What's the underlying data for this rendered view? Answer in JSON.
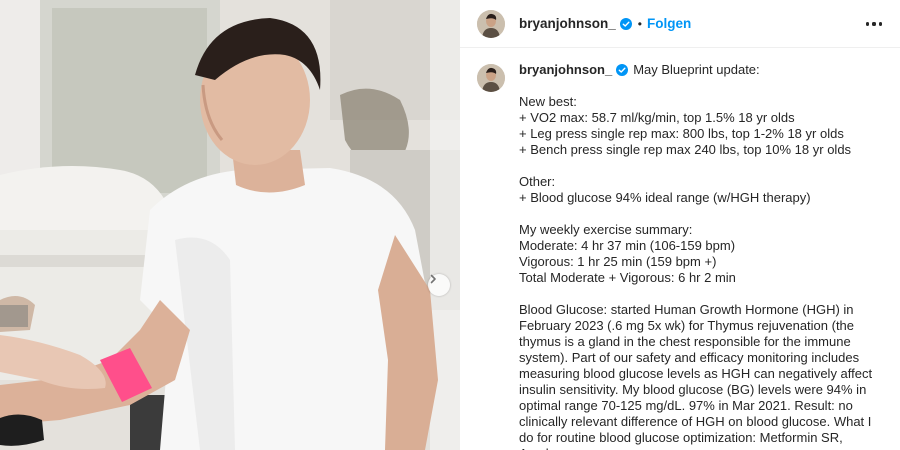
{
  "post": {
    "username": "bryanjohnson_",
    "follow_label": "Folgen",
    "separator": "•",
    "verified_icon": "verified-badge-icon",
    "more_icon": "more-options-icon"
  },
  "caption": {
    "username": "bryanjohnson_",
    "title": "May Blueprint update:",
    "new_best": {
      "heading": "New best:",
      "lines": [
        "+ VO2 max: 58.7 ml/kg/min, top 1.5% 18 yr olds",
        "+ Leg press single rep max: 800 lbs, top 1-2% 18 yr olds",
        "+ Bench press single rep max 240 lbs, top 10% 18 yr olds"
      ]
    },
    "other": {
      "heading": "Other:",
      "lines": [
        "+ Blood glucose 94% ideal range (w/HGH therapy)"
      ]
    },
    "exercise": {
      "heading": "My weekly exercise summary:",
      "lines": [
        "Moderate: 4 hr 37 min (106-159 bpm)",
        "Vigorous: 1 hr 25 min (159 bpm +)",
        "Total Moderate + Vigorous: 6 hr 2 min"
      ]
    },
    "blood_glucose": "Blood Glucose: started Human Growth Hormone (HGH) in February 2023 (.6 mg 5x wk) for Thymus rejuvenation (the thymus is a gland in the chest responsible for the immune system). Part of our safety and efficacy monitoring includes measuring blood glucose levels as HGH can negatively affect insulin sensitivity. My blood glucose (BG) levels were 94% in optimal range 70-125 mg/dL. 97% in Mar 2021. Result: no clinically relevant difference of HGH on blood glucose. What I do for routine blood glucose optimization: Metformin SR, Acarbose"
  },
  "media": {
    "carousel_icon": "chevron-right-icon"
  },
  "colors": {
    "accent": "#0095f6",
    "text": "#262626",
    "divider": "#efefef",
    "tourniquet": "#ff4f8b"
  }
}
